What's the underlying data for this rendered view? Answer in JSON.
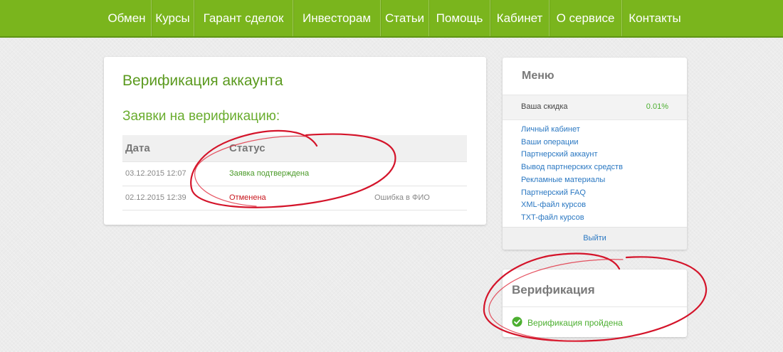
{
  "nav": {
    "items": [
      {
        "label": "Обмен"
      },
      {
        "label": "Курсы"
      },
      {
        "label": "Гарант сделок"
      },
      {
        "label": "Инвесторам"
      },
      {
        "label": "Статьи"
      },
      {
        "label": "Помощь"
      },
      {
        "label": "Кабинет"
      },
      {
        "label": "О сервисе"
      },
      {
        "label": "Контакты"
      }
    ]
  },
  "main": {
    "title": "Верификация аккаунта",
    "section_title": "Заявки на верификацию:",
    "table": {
      "headers": [
        "Дата",
        "Статус"
      ],
      "rows": [
        {
          "date": "03.12.2015 12:07",
          "status": "Заявка подтверждена",
          "note": ""
        },
        {
          "date": "02.12.2015 12:39",
          "status": "Отменена",
          "note": "Ошибка в ФИО"
        }
      ]
    }
  },
  "menu": {
    "title": "Меню",
    "discount_label": "Ваша скидка",
    "discount_value": "0.01%",
    "links": [
      "Личный кабинет",
      "Ваши операции",
      "Партнерский аккаунт",
      "Вывод партнерских средств",
      "Рекламные материалы",
      "Партнерский FAQ",
      "XML-файл курсов",
      "TXT-файл курсов"
    ],
    "logout": "Выйти"
  },
  "verification": {
    "title": "Верификация",
    "status_text": "Верификация пройдена",
    "status_icon": "check-circle-icon"
  },
  "colors": {
    "nav_bg": "#7ab51d",
    "accent_green": "#5b9a1f",
    "status_ok": "#4a9a28",
    "status_cancelled": "#c8161d",
    "link": "#2b78c2",
    "annotation_red": "#d4142a"
  }
}
